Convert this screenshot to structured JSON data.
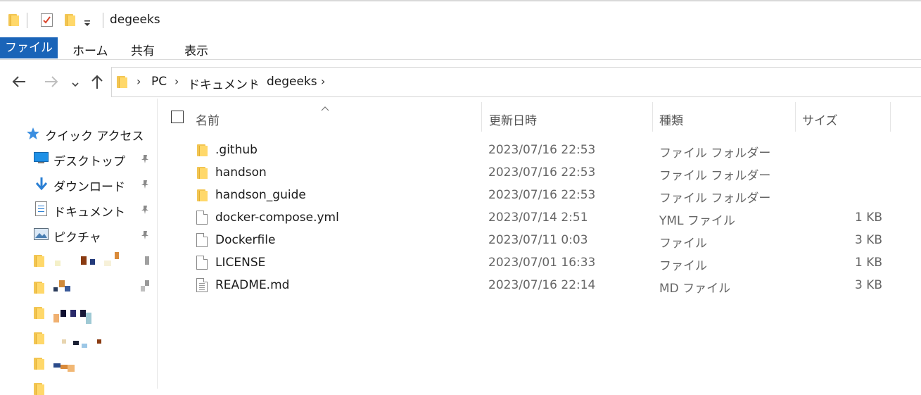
{
  "window": {
    "title": "degeeks"
  },
  "ribbon": {
    "tabs": [
      {
        "label": "ファイル",
        "active": true
      },
      {
        "label": "ホーム"
      },
      {
        "label": "共有"
      },
      {
        "label": "表示"
      }
    ],
    "accent_color": "#1a64b8"
  },
  "address": {
    "crumbs": [
      "PC",
      "ドキュメント",
      "degeeks"
    ]
  },
  "sidebar": {
    "quick_access_label": "クイック アクセス",
    "items": [
      {
        "label": "デスクトップ",
        "icon": "desktop-icon",
        "pinned": true
      },
      {
        "label": "ダウンロード",
        "icon": "download-arrow-icon",
        "pinned": true
      },
      {
        "label": "ドキュメント",
        "icon": "document-icon",
        "pinned": true
      },
      {
        "label": "ピクチャ",
        "icon": "picture-icon",
        "pinned": true
      }
    ]
  },
  "columns": {
    "name": "名前",
    "date": "更新日時",
    "type": "種類",
    "size": "サイズ"
  },
  "files": [
    {
      "name": ".github",
      "date": "2023/07/16 22:53",
      "type": "ファイル フォルダー",
      "size": "",
      "kind": "folder"
    },
    {
      "name": "handson",
      "date": "2023/07/16 22:53",
      "type": "ファイル フォルダー",
      "size": "",
      "kind": "folder"
    },
    {
      "name": "handson_guide",
      "date": "2023/07/16 22:53",
      "type": "ファイル フォルダー",
      "size": "",
      "kind": "folder"
    },
    {
      "name": "docker-compose.yml",
      "date": "2023/07/14 2:51",
      "type": "YML ファイル",
      "size": "1 KB",
      "kind": "file"
    },
    {
      "name": "Dockerfile",
      "date": "2023/07/11 0:03",
      "type": "ファイル",
      "size": "3 KB",
      "kind": "file"
    },
    {
      "name": "LICENSE",
      "date": "2023/07/01 16:33",
      "type": "ファイル",
      "size": "1 KB",
      "kind": "file"
    },
    {
      "name": "README.md",
      "date": "2023/07/16 22:14",
      "type": "MD ファイル",
      "size": "3 KB",
      "kind": "text-file"
    }
  ]
}
